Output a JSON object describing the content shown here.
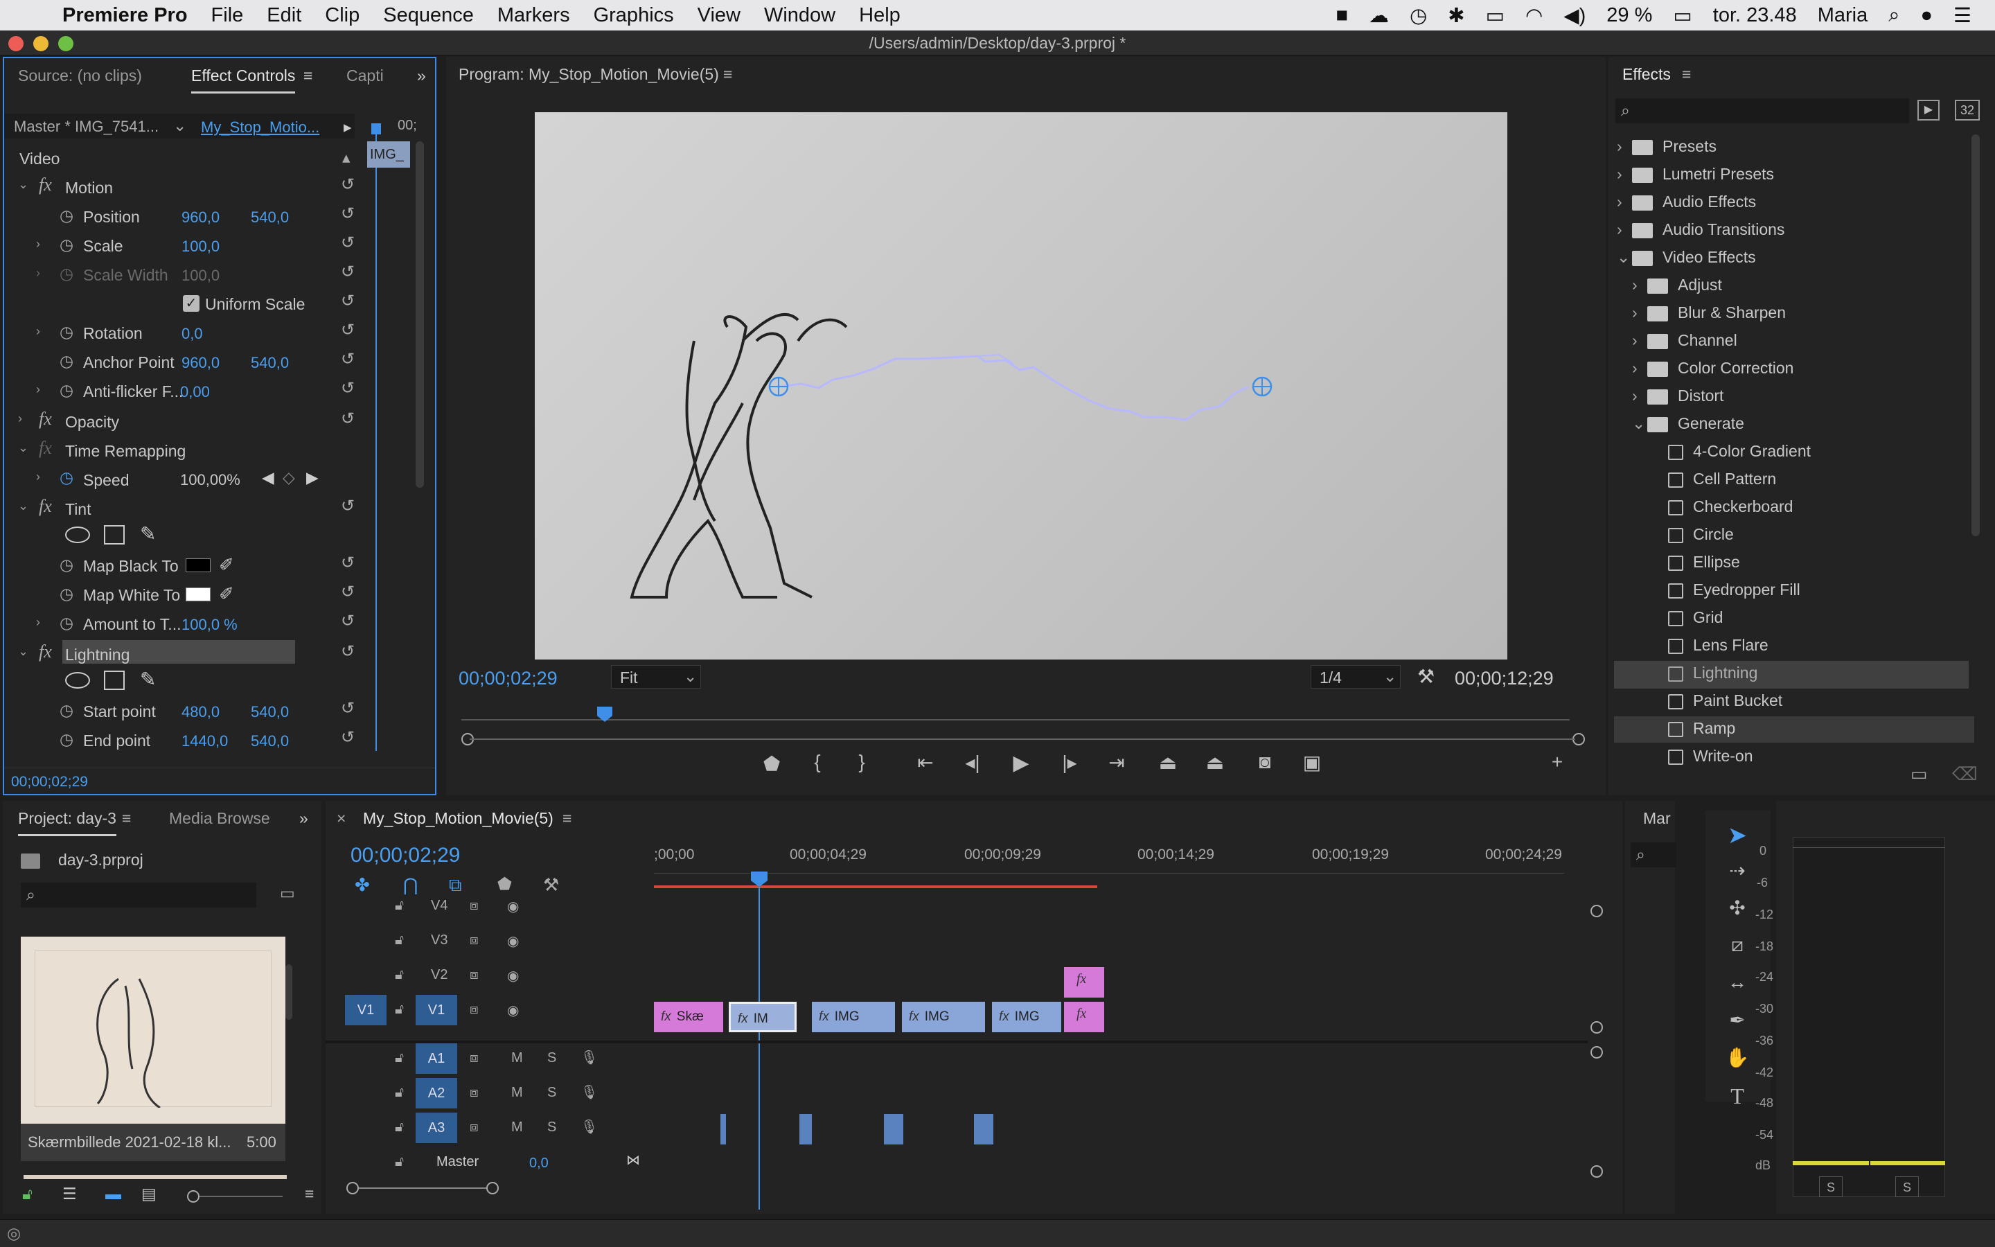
{
  "menubar": {
    "app": "Premiere Pro",
    "items": [
      "File",
      "Edit",
      "Clip",
      "Sequence",
      "Markers",
      "Graphics",
      "View",
      "Window",
      "Help"
    ],
    "battery": "29 %",
    "clock": "tor. 23.48",
    "user": "Maria"
  },
  "window": {
    "title": "/Users/admin/Desktop/day-3.prproj *"
  },
  "effect_controls": {
    "tab_source": "Source: (no clips)",
    "tab_effect": "Effect Controls",
    "tab_capt": "Capti",
    "master": "Master * IMG_7541...",
    "sequence": "My_Stop_Motio...",
    "ruler_time": "00;",
    "mini_clip": "IMG_",
    "video_header": "Video",
    "motion": "Motion",
    "position": {
      "label": "Position",
      "x": "960,0",
      "y": "540,0"
    },
    "scale": {
      "label": "Scale",
      "v": "100,0"
    },
    "scale_width": {
      "label": "Scale Width",
      "v": "100,0"
    },
    "uniform": "Uniform Scale",
    "rotation": {
      "label": "Rotation",
      "v": "0,0"
    },
    "anchor": {
      "label": "Anchor Point",
      "x": "960,0",
      "y": "540,0"
    },
    "antiflicker": {
      "label": "Anti-flicker F...",
      "v": "0,00"
    },
    "opacity": "Opacity",
    "time_remap": "Time Remapping",
    "speed": {
      "label": "Speed",
      "v": "100,00%"
    },
    "tint": "Tint",
    "map_black": "Map Black To",
    "map_white": "Map White To",
    "amount": {
      "label": "Amount to T...",
      "v": "100,0 %"
    },
    "lightning": "Lightning",
    "start": {
      "label": "Start point",
      "x": "480,0",
      "y": "540,0"
    },
    "end": {
      "label": "End point",
      "x": "1440,0",
      "y": "540,0"
    },
    "timecode": "00;00;02;29"
  },
  "program": {
    "title": "Program: My_Stop_Motion_Movie(5)",
    "timecode": "00;00;02;29",
    "fit": "Fit",
    "quality": "1/4",
    "duration": "00;00;12;29"
  },
  "effects": {
    "title": "Effects",
    "btn32": "32",
    "top_folders": [
      "Presets",
      "Lumetri Presets",
      "Audio Effects",
      "Audio Transitions",
      "Video Effects"
    ],
    "sub_folders": [
      "Adjust",
      "Blur & Sharpen",
      "Channel",
      "Color Correction",
      "Distort",
      "Generate"
    ],
    "generate_items": [
      "4-Color Gradient",
      "Cell Pattern",
      "Checkerboard",
      "Circle",
      "Ellipse",
      "Eyedropper Fill",
      "Grid",
      "Lens Flare",
      "Lightning",
      "Paint Bucket",
      "Ramp",
      "Write-on"
    ],
    "selected": "Lightning"
  },
  "project": {
    "tab_project": "Project: day-3",
    "tab_media": "Media Browse",
    "file": "day-3.prproj",
    "clip_name": "Skærmbillede 2021-02-18 kl...",
    "clip_dur": "5:00"
  },
  "timeline": {
    "seq_name": "My_Stop_Motion_Movie(5)",
    "timecode": "00;00;02;29",
    "ruler": [
      ";00;00",
      "00;00;04;29",
      "00;00;09;29",
      "00;00;14;29",
      "00;00;19;29",
      "00;00;24;29"
    ],
    "tracks_video": [
      "V4",
      "V3",
      "V2",
      "V1"
    ],
    "source_v": "V1",
    "tracks_audio": [
      "A1",
      "A2",
      "A3"
    ],
    "master": "Master",
    "master_val": "0,0",
    "clips": [
      "Skæ",
      "IM",
      "IMG",
      "IMG",
      "IMG"
    ]
  },
  "markers_panel": {
    "title": "Mar"
  },
  "meter": {
    "scale": [
      "0",
      "-6",
      "-12",
      "-18",
      "-24",
      "-30",
      "-36",
      "-42",
      "-48",
      "-54",
      "dB"
    ],
    "solo": [
      "S",
      "S"
    ]
  },
  "colors": {
    "accent": "#2d8ceb",
    "timecode": "#4a9ff0",
    "clip_pink": "#d67ad9",
    "clip_blue": "#8aa5d8",
    "playhead": "#3f8fe8"
  }
}
